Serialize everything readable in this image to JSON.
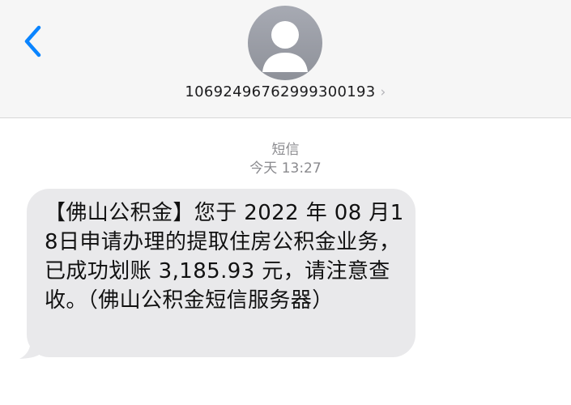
{
  "header": {
    "sender_number": "106924967629993 00193",
    "sender_number_display": "1069249676299930019 3"
  },
  "thread": {
    "label": "短信",
    "timestamp": "今天 13:27"
  },
  "message": {
    "text": "【佛山公积金】您于 2022 年 08 月18日申请办理的提取住房公积金业务，已成功划账 3,185.93 元，请注意查收。（佛山公积金短信服务器）"
  },
  "icons": {
    "back": "chevron-left-icon",
    "avatar": "person-icon",
    "contact_detail": "chevron-right-icon"
  },
  "colors": {
    "accent": "#0a84ff",
    "bubble": "#e9e9eb",
    "header_bg": "#f6f6f6"
  }
}
